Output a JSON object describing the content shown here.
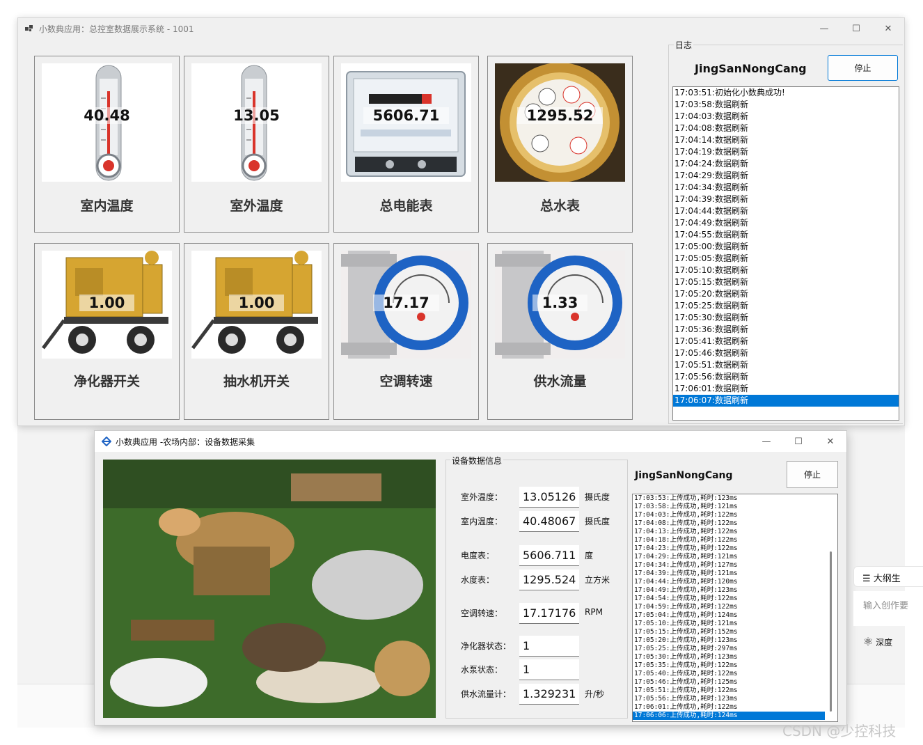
{
  "window1": {
    "title": "小数典应用：总控室数据展示系统 - 1001",
    "controls": {
      "minimize": "—",
      "maximize": "☐",
      "close": "✕"
    },
    "tiles": [
      {
        "value": "40.48",
        "label": "室内温度",
        "image": "thermometer"
      },
      {
        "value": "13.05",
        "label": "室外温度",
        "image": "thermometer"
      },
      {
        "value": "5606.71",
        "label": "总电能表",
        "image": "electric-meter"
      },
      {
        "value": "1295.52",
        "label": "总水表",
        "image": "water-meter"
      },
      {
        "value": "1.00",
        "label": "净化器开关",
        "image": "pump-trailer"
      },
      {
        "value": "1.00",
        "label": "抽水机开关",
        "image": "pump-trailer"
      },
      {
        "value": "17.17",
        "label": "空调转速",
        "image": "flowmeter"
      },
      {
        "value": "1.33",
        "label": "供水流量",
        "image": "flowmeter"
      }
    ],
    "log": {
      "legend": "日志",
      "name": "JingSanNongCang",
      "stop_label": "停止",
      "items": [
        "17:03:51:初始化小数典成功!",
        "17:03:58:数据刷新",
        "17:04:03:数据刷新",
        "17:04:08:数据刷新",
        "17:04:14:数据刷新",
        "17:04:19:数据刷新",
        "17:04:24:数据刷新",
        "17:04:29:数据刷新",
        "17:04:34:数据刷新",
        "17:04:39:数据刷新",
        "17:04:44:数据刷新",
        "17:04:49:数据刷新",
        "17:04:55:数据刷新",
        "17:05:00:数据刷新",
        "17:05:05:数据刷新",
        "17:05:10:数据刷新",
        "17:05:15:数据刷新",
        "17:05:20:数据刷新",
        "17:05:25:数据刷新",
        "17:05:30:数据刷新",
        "17:05:36:数据刷新",
        "17:05:41:数据刷新",
        "17:05:46:数据刷新",
        "17:05:51:数据刷新",
        "17:05:56:数据刷新",
        "17:06:01:数据刷新",
        "17:06:07:数据刷新"
      ],
      "selected_index": 26
    }
  },
  "window2": {
    "title": "小数典应用 -农场内部：设备数据采集",
    "controls": {
      "minimize": "—",
      "maximize": "☐",
      "close": "✕"
    },
    "group_title": "设备数据信息",
    "fields": [
      {
        "label": "室外温度：",
        "value": "13.05126",
        "unit": "摄氏度"
      },
      {
        "label": "室内温度：",
        "value": "40.48067",
        "unit": "摄氏度"
      },
      {
        "label": "电度表：",
        "value": "5606.711",
        "unit": "度"
      },
      {
        "label": "水度表：",
        "value": "1295.524",
        "unit": "立方米"
      },
      {
        "label": "空调转速：",
        "value": "17.17176",
        "unit": "RPM"
      },
      {
        "label": "净化器状态：",
        "value": "1",
        "unit": ""
      },
      {
        "label": "水泵状态：",
        "value": "1",
        "unit": ""
      },
      {
        "label": "供水流量计：",
        "value": "1.329231",
        "unit": "升/秒"
      }
    ],
    "log": {
      "name": "JingSanNongCang",
      "stop_label": "停止",
      "items": [
        "17:03:53:上传成功,耗时:123ms",
        "17:03:58:上传成功,耗时:121ms",
        "17:04:03:上传成功,耗时:122ms",
        "17:04:08:上传成功,耗时:122ms",
        "17:04:13:上传成功,耗时:122ms",
        "17:04:18:上传成功,耗时:122ms",
        "17:04:23:上传成功,耗时:122ms",
        "17:04:29:上传成功,耗时:121ms",
        "17:04:34:上传成功,耗时:127ms",
        "17:04:39:上传成功,耗时:121ms",
        "17:04:44:上传成功,耗时:120ms",
        "17:04:49:上传成功,耗时:123ms",
        "17:04:54:上传成功,耗时:122ms",
        "17:04:59:上传成功,耗时:122ms",
        "17:05:04:上传成功,耗时:124ms",
        "17:05:10:上传成功,耗时:121ms",
        "17:05:15:上传成功,耗时:152ms",
        "17:05:20:上传成功,耗时:123ms",
        "17:05:25:上传成功,耗时:297ms",
        "17:05:30:上传成功,耗时:123ms",
        "17:05:35:上传成功,耗时:122ms",
        "17:05:40:上传成功,耗时:122ms",
        "17:05:46:上传成功,耗时:125ms",
        "17:05:51:上传成功,耗时:122ms",
        "17:05:56:上传成功,耗时:123ms",
        "17:06:01:上传成功,耗时:122ms",
        "17:06:06:上传成功,耗时:124ms"
      ],
      "selected_index": 26
    }
  },
  "side": {
    "outline_button": "大纲生",
    "input_placeholder": "输入创作要",
    "deep_label": "深度"
  },
  "watermark": "CSDN @少控科技",
  "colors": {
    "accent": "#0078d7",
    "window_bg": "#f0f0f0",
    "border": "#8a8a8a"
  }
}
